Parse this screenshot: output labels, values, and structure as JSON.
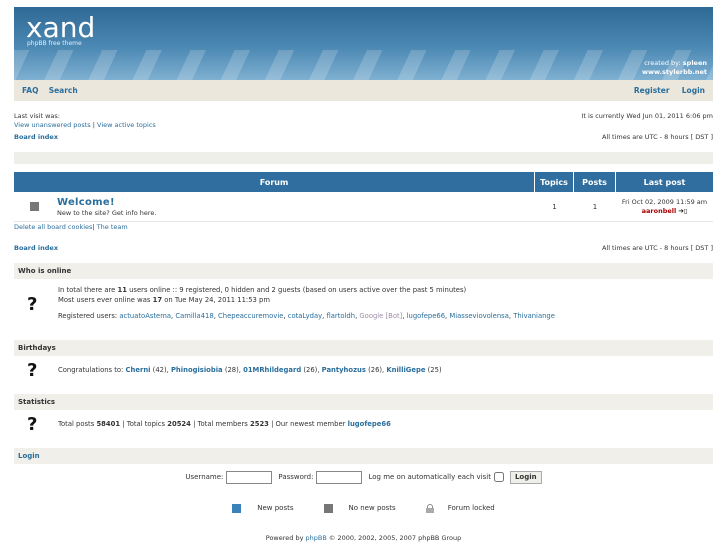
{
  "header": {
    "logo": "xand",
    "tagline": "phpBB free theme",
    "credits_line1_prefix": "created by:",
    "credits_author": "spleen",
    "credits_line2": "www.stylerbb.net"
  },
  "nav": {
    "faq": "FAQ",
    "search": "Search",
    "register": "Register",
    "login": "Login"
  },
  "meta": {
    "last_visit": "Last visit was:",
    "unanswered": "View unanswered posts",
    "separator": "|",
    "active": "View active topics",
    "current_time": "It is currently Wed Jun 01, 2011 6:06 pm",
    "board_index": "Board index",
    "timezone": "All times are UTC - 8 hours [ DST ]"
  },
  "forum_table": {
    "headers": [
      "Forum",
      "Topics",
      "Posts",
      "Last post"
    ],
    "rows": [
      {
        "title": "Welcome!",
        "description": "New to the site? Get info here.",
        "topics": "1",
        "posts": "1",
        "last_post_date": "Fri Oct 02, 2009 11:59 am",
        "last_post_author": "aaronbell"
      }
    ]
  },
  "after_table": {
    "delete_cookies": "Delete all board cookies",
    "separator": "|",
    "team": "The team",
    "board_index": "Board index",
    "timezone": "All times are UTC - 8 hours [ DST ]"
  },
  "online": {
    "title": "Who is online",
    "line1_a": "In total there are",
    "line1_count": "11",
    "line1_b": "users online :: 9 registered, 0 hidden and 2 guests (based on users active over the past 5 minutes)",
    "line2_a": "Most users ever online was",
    "line2_count": "17",
    "line2_b": "on Tue May 24, 2011 11:53 pm",
    "registered_label": "Registered users:",
    "users": [
      "actuatoAstema",
      "Camilla418",
      "Chepeaccuremovie",
      "cotaLyday",
      "flartoldh"
    ],
    "bot": "Google [Bot]",
    "users_after": [
      "lugofepe66",
      "Miasseviovolensa",
      "Thivaniange"
    ]
  },
  "birthdays": {
    "title": "Birthdays",
    "label": "Congratulations to:",
    "people": [
      {
        "name": "Cherni",
        "age": "(42)"
      },
      {
        "name": "Phinogisiobia",
        "age": "(28)"
      },
      {
        "name": "01MRhildegard",
        "age": "(26)"
      },
      {
        "name": "Pantyhozus",
        "age": "(26)"
      },
      {
        "name": "KnilliGepe",
        "age": "(25)"
      }
    ]
  },
  "statistics": {
    "title": "Statistics",
    "posts_label": "Total posts",
    "posts": "58401",
    "topics_label": "| Total topics",
    "topics": "20524",
    "members_label": "| Total members",
    "members": "2523",
    "newest_label": "| Our newest member",
    "newest": "lugofepe66"
  },
  "login": {
    "title": "Login",
    "username_label": "Username:",
    "password_label": "Password:",
    "auto_label": "Log me on automatically each visit",
    "button": "Login"
  },
  "legend": {
    "new_posts": "New posts",
    "no_new_posts": "No new posts",
    "locked": "Forum locked",
    "new_color": "#3b82b8",
    "no_new_color": "#777777"
  },
  "footer": {
    "text_a": "Powered by",
    "phpbb": "phpBB",
    "text_b": "© 2000, 2002, 2005, 2007 phpBB Group"
  }
}
